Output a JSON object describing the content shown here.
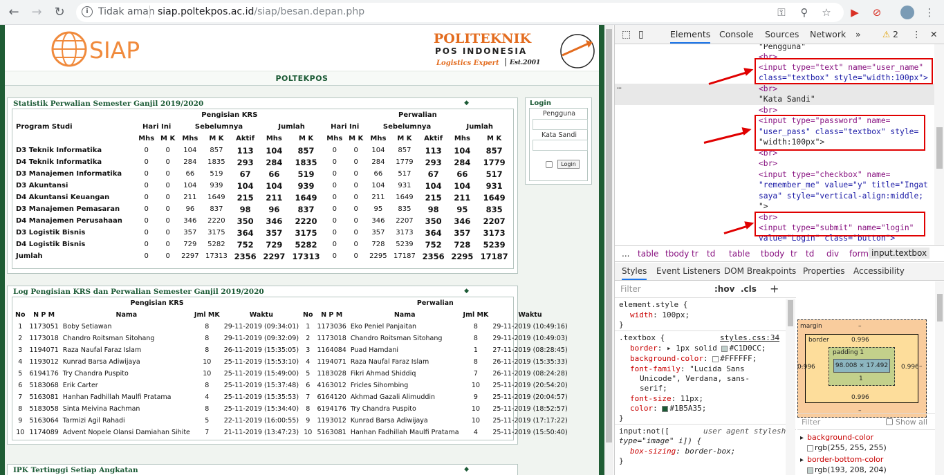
{
  "browser": {
    "security_label": "Tidak aman",
    "url_host": "siap.poltekpos.ac.id",
    "url_path": "/siap/besan.depan.php"
  },
  "site": {
    "logo_text": "SIAP",
    "brand_name": "POLITEKNIK",
    "brand_sub": "POS INDONESIA",
    "brand_tagline": "Logistics Expert",
    "brand_est": "Est.2001",
    "banner": "POLTEKPOS"
  },
  "stats": {
    "title": "Statistik Perwalian Semester Ganjil 2019/2020",
    "group_krs": "Pengisian KRS",
    "group_perwalian": "Perwalian",
    "col_program": "Program Studi",
    "sub_hari_ini": "Hari Ini",
    "sub_sebelumnya": "Sebelumnya",
    "sub_jumlah": "Jumlah",
    "col_mhs": "Mhs",
    "col_mk": "M K",
    "col_aktif": "Aktif",
    "rows": [
      {
        "name": "D3 Teknik Informatika",
        "v": [
          "0",
          "0",
          "104",
          "857",
          "113",
          "104",
          "857",
          "0",
          "0",
          "104",
          "857",
          "113",
          "104",
          "857"
        ]
      },
      {
        "name": "D4 Teknik Informatika",
        "v": [
          "0",
          "0",
          "284",
          "1835",
          "293",
          "284",
          "1835",
          "0",
          "0",
          "284",
          "1779",
          "293",
          "284",
          "1779"
        ]
      },
      {
        "name": "D3 Manajemen Informatika",
        "v": [
          "0",
          "0",
          "66",
          "519",
          "67",
          "66",
          "519",
          "0",
          "0",
          "66",
          "517",
          "67",
          "66",
          "517"
        ]
      },
      {
        "name": "D3 Akuntansi",
        "v": [
          "0",
          "0",
          "104",
          "939",
          "104",
          "104",
          "939",
          "0",
          "0",
          "104",
          "931",
          "104",
          "104",
          "931"
        ]
      },
      {
        "name": "D4 Akuntansi Keuangan",
        "v": [
          "0",
          "0",
          "211",
          "1649",
          "215",
          "211",
          "1649",
          "0",
          "0",
          "211",
          "1649",
          "215",
          "211",
          "1649"
        ]
      },
      {
        "name": "D3 Manajemen Pemasaran",
        "v": [
          "0",
          "0",
          "96",
          "837",
          "98",
          "96",
          "837",
          "0",
          "0",
          "95",
          "835",
          "98",
          "95",
          "835"
        ]
      },
      {
        "name": "D4 Manajemen Perusahaan",
        "v": [
          "0",
          "0",
          "346",
          "2220",
          "350",
          "346",
          "2220",
          "0",
          "0",
          "346",
          "2207",
          "350",
          "346",
          "2207"
        ]
      },
      {
        "name": "D3 Logistik Bisnis",
        "v": [
          "0",
          "0",
          "357",
          "3175",
          "364",
          "357",
          "3175",
          "0",
          "0",
          "357",
          "3173",
          "364",
          "357",
          "3173"
        ]
      },
      {
        "name": "D4 Logistik Bisnis",
        "v": [
          "0",
          "0",
          "729",
          "5282",
          "752",
          "729",
          "5282",
          "0",
          "0",
          "728",
          "5239",
          "752",
          "728",
          "5239"
        ]
      },
      {
        "name": "Jumlah",
        "v": [
          "0",
          "0",
          "2297",
          "17313",
          "2356",
          "2297",
          "17313",
          "0",
          "0",
          "2295",
          "17187",
          "2356",
          "2295",
          "17187"
        ]
      }
    ]
  },
  "log": {
    "title": "Log Pengisian KRS dan Perwalian Semester Ganjil 2019/2020",
    "group_krs": "Pengisian KRS",
    "group_perwalian": "Perwalian",
    "col_no": "No",
    "col_npm": "N P M",
    "col_nama": "Nama",
    "col_jml": "Jml MK",
    "col_waktu": "Waktu",
    "rows": [
      {
        "no": "1",
        "npm": "1173051",
        "nama": "Boby Setiawan",
        "jml": "8",
        "waktu": "29-11-2019 (09:34:01)",
        "no2": "1",
        "npm2": "1173036",
        "nama2": "Eko Peniel Panjaitan",
        "jml2": "8",
        "waktu2": "29-11-2019 (10:49:16)"
      },
      {
        "no": "2",
        "npm": "1173018",
        "nama": "Chandro Roitsman Sitohang",
        "jml": "8",
        "waktu": "29-11-2019 (09:32:09)",
        "no2": "2",
        "npm2": "1173018",
        "nama2": "Chandro Roitsman Sitohang",
        "jml2": "8",
        "waktu2": "29-11-2019 (10:49:03)"
      },
      {
        "no": "3",
        "npm": "1194071",
        "nama": "Raza Naufal Faraz Islam",
        "jml": "8",
        "waktu": "26-11-2019 (15:35:05)",
        "no2": "3",
        "npm2": "1164084",
        "nama2": "Puad Hamdani",
        "jml2": "1",
        "waktu2": "27-11-2019 (08:28:45)"
      },
      {
        "no": "4",
        "npm": "1193012",
        "nama": "Kunrad Barsa Adiwijaya",
        "jml": "10",
        "waktu": "25-11-2019 (15:53:10)",
        "no2": "4",
        "npm2": "1194071",
        "nama2": "Raza Naufal Faraz Islam",
        "jml2": "8",
        "waktu2": "26-11-2019 (15:35:33)"
      },
      {
        "no": "5",
        "npm": "6194176",
        "nama": "Try Chandra Puspito",
        "jml": "10",
        "waktu": "25-11-2019 (15:49:00)",
        "no2": "5",
        "npm2": "1183028",
        "nama2": "Fikri Ahmad Shiddiq",
        "jml2": "7",
        "waktu2": "26-11-2019 (08:24:28)"
      },
      {
        "no": "6",
        "npm": "5183068",
        "nama": "Erik Carter",
        "jml": "8",
        "waktu": "25-11-2019 (15:37:48)",
        "no2": "6",
        "npm2": "4163012",
        "nama2": "Fricles Sihombing",
        "jml2": "10",
        "waktu2": "25-11-2019 (20:54:20)"
      },
      {
        "no": "7",
        "npm": "5163081",
        "nama": "Hanhan Fadhillah Maulfi Pratama",
        "jml": "4",
        "waktu": "25-11-2019 (15:35:53)",
        "no2": "7",
        "npm2": "6164120",
        "nama2": "Akhmad Gazali Alimuddin",
        "jml2": "9",
        "waktu2": "25-11-2019 (20:04:57)"
      },
      {
        "no": "8",
        "npm": "5183058",
        "nama": "Sinta Meivina Rachman",
        "jml": "8",
        "waktu": "25-11-2019 (15:34:40)",
        "no2": "8",
        "npm2": "6194176",
        "nama2": "Try Chandra Puspito",
        "jml2": "10",
        "waktu2": "25-11-2019 (18:52:57)"
      },
      {
        "no": "9",
        "npm": "5163064",
        "nama": "Tarmizi Agil Rahadi",
        "jml": "5",
        "waktu": "22-11-2019 (16:00:55)",
        "no2": "9",
        "npm2": "1193012",
        "nama2": "Kunrad Barsa Adiwijaya",
        "jml2": "10",
        "waktu2": "25-11-2019 (17:17:22)"
      },
      {
        "no": "10",
        "npm": "1174089",
        "nama": "Advent Nopele Olansi Damiahan Sihite",
        "jml": "7",
        "waktu": "21-11-2019 (13:47:23)",
        "no2": "10",
        "npm2": "5163081",
        "nama2": "Hanhan Fadhillah Maulfi Pratama",
        "jml2": "4",
        "waktu2": "25-11-2019 (15:50:40)"
      }
    ]
  },
  "ipk": {
    "title": "IPK Tertinggi Setiap Angkatan"
  },
  "login": {
    "title": "Login",
    "user_label": "Pengguna",
    "pass_label": "Kata Sandi",
    "button": "Login"
  },
  "devtools": {
    "tabs": [
      "Elements",
      "Console",
      "Sources",
      "Network"
    ],
    "warning_count": "2",
    "code_lines": [
      "\"Pengguna\"",
      "<br>",
      "<input type=\"text\" name=\"user_name\"",
      "class=\"textbox\" style=\"width:100px\">",
      "<br>",
      "\"Kata Sandi\"",
      "<br>",
      "<input type=\"password\" name=",
      "\"user_pass\" class=\"textbox\" style=",
      "\"width:100px\">",
      "<br>",
      "<br>",
      "<input type=\"checkbox\" name=",
      "\"remember_me\" value=\"y\" title=\"Ingat",
      "saya\" style=\"vertical-align:middle;",
      "\">",
      "<br>",
      "<input type=\"submit\" name=\"login\"",
      "value=\"Login\" class=\"button\">",
      "<br>"
    ],
    "breadcrumb": [
      "...",
      "table",
      "tbody",
      "tr",
      "td",
      "table",
      "tbody",
      "tr",
      "td",
      "div",
      "form",
      "input.textbox"
    ],
    "style_tabs": [
      "Styles",
      "Event Listeners",
      "DOM Breakpoints",
      "Properties",
      "Accessibility"
    ],
    "filter_placeholder": "Filter",
    "hov": ":hov",
    "cls": ".cls",
    "rules": {
      "element_style": "element.style {",
      "width_prop": "width",
      "width_val": "100px;",
      "textbox_sel": ".textbox {",
      "textbox_link": "styles.css:34",
      "border_prop": "border",
      "border_val": "1px solid",
      "border_color": "#C1D0CC;",
      "bg_prop": "background-color",
      "bg_val": "#FFFFFF;",
      "ff_prop": "font-family",
      "ff_val1": "\"Lucida Sans",
      "ff_val2": "Unicode\", Verdana, sans-",
      "ff_val3": "serif;",
      "fs_prop": "font-size",
      "fs_val": "11px;",
      "color_prop": "color",
      "color_val": "#1B5A35;",
      "ua_sel": "input:not([",
      "ua_label": "user agent stylesheet",
      "ua_sel2": "type=\"image\" i]) {",
      "bs_prop": "box-sizing",
      "bs_val": "border-box;"
    },
    "boxmodel": {
      "margin": "margin",
      "border": "border",
      "padding": "padding 1",
      "content": "98.008 × 17.492",
      "border_val": "0.996",
      "padding_bottom": "1",
      "dash": "–"
    },
    "computed": {
      "filter": "Filter",
      "show_all": "Show all",
      "p1": "background-color",
      "v1": "rgb(255, 255, 255)",
      "p2": "border-bottom-color",
      "v2": "rgb(193, 208, 204)"
    }
  },
  "colors": {
    "brand_green": "#1b5a35",
    "highlight_red": "#e00000",
    "logo_orange": "#f08a3c"
  }
}
